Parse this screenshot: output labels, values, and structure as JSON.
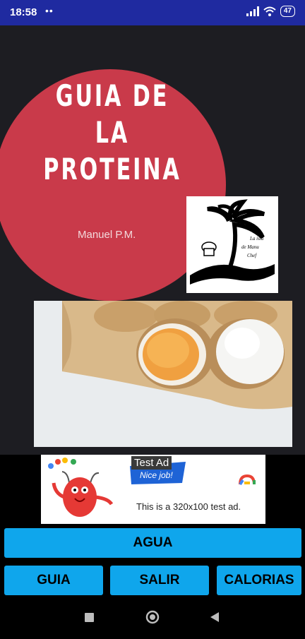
{
  "status_bar": {
    "time": "18:58",
    "dots": "••",
    "battery": "47"
  },
  "cover": {
    "title_lines": [
      "GUIA DE",
      "LA",
      "PROTEINA"
    ],
    "author": "Manuel P.M.",
    "logo_text": [
      "La isla",
      "de Manu",
      "Chef"
    ]
  },
  "ad": {
    "label": "Test Ad",
    "badge": "Nice job!",
    "text": "This is a 320x100 test ad."
  },
  "buttons": {
    "agua": "AGUA",
    "guia": "GUIA",
    "salir": "SALIR",
    "calorias": "CALORIAS"
  },
  "colors": {
    "status_bar": "#1f2aa0",
    "circle": "#c93a4a",
    "button": "#0fa6ec",
    "background": "#1d1d22"
  }
}
